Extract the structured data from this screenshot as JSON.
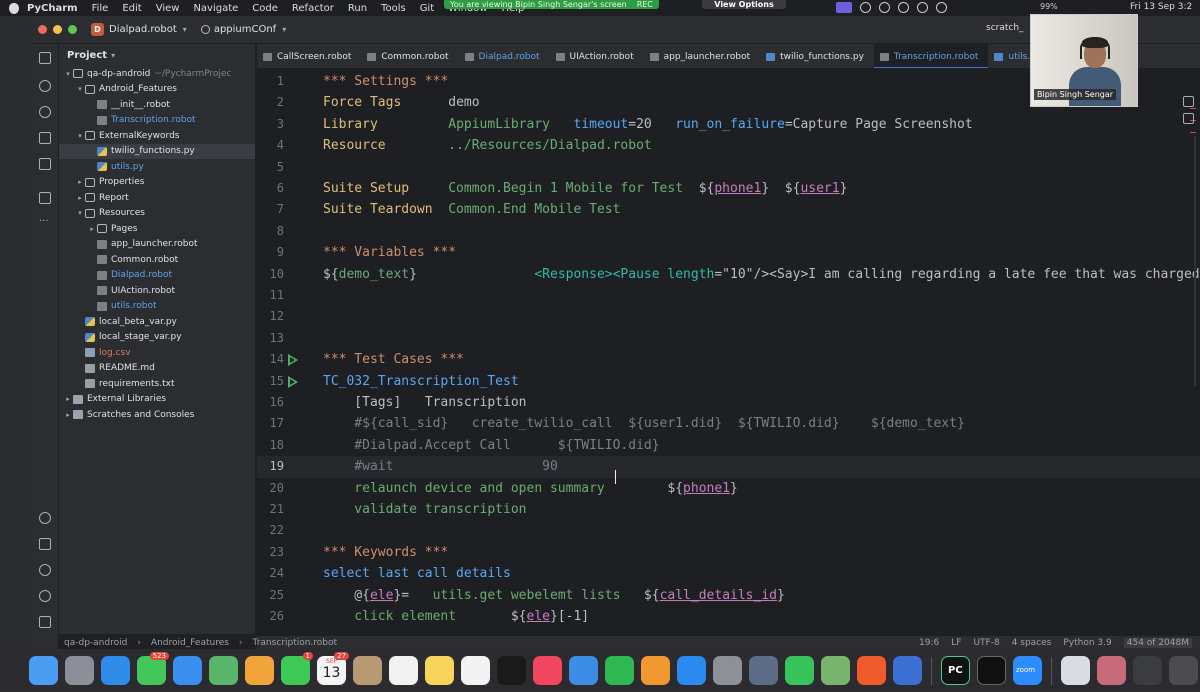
{
  "menubar": {
    "app": "PyCharm",
    "items": [
      "File",
      "Edit",
      "View",
      "Navigate",
      "Code",
      "Refactor",
      "Run",
      "Tools",
      "Git",
      "Window",
      "Help"
    ],
    "share_text": "You are viewing  Bipin Singh Sengar's screen",
    "rec_label": "REC",
    "view_options": "View Options",
    "battery": "99%",
    "clock": "Fri 13 Sep 3:2"
  },
  "titlebar": {
    "project_badge": "D",
    "project": "Dialpad.robot",
    "branch": "appiumCOnf",
    "scratch": "scratch_"
  },
  "project_panel": {
    "title": "Project",
    "rows": [
      {
        "label": "qa-dp-android",
        "suffix": "~/PycharmProjec",
        "depth": 0,
        "arrow": "▾",
        "icon": "folder",
        "style": ""
      },
      {
        "label": "Android_Features",
        "depth": 1,
        "arrow": "▾",
        "icon": "folder",
        "style": ""
      },
      {
        "label": "__init__.robot",
        "depth": 2,
        "arrow": "",
        "icon": "robot",
        "style": ""
      },
      {
        "label": "Transcription.robot",
        "depth": 2,
        "arrow": "",
        "icon": "robot",
        "style": "blue"
      },
      {
        "label": "ExternalKeywords",
        "depth": 1,
        "arrow": "▾",
        "icon": "folder",
        "style": ""
      },
      {
        "label": "twilio_functions.py",
        "depth": 2,
        "arrow": "",
        "icon": "pyy",
        "style": "",
        "selected": true
      },
      {
        "label": "utils.py",
        "depth": 2,
        "arrow": "",
        "icon": "pyy",
        "style": "blue"
      },
      {
        "label": "Properties",
        "depth": 1,
        "arrow": "▸",
        "icon": "folder",
        "style": ""
      },
      {
        "label": "Report",
        "depth": 1,
        "arrow": "▸",
        "icon": "folder",
        "style": ""
      },
      {
        "label": "Resources",
        "depth": 1,
        "arrow": "▾",
        "icon": "folder",
        "style": ""
      },
      {
        "label": "Pages",
        "depth": 2,
        "arrow": "▸",
        "icon": "folder",
        "style": ""
      },
      {
        "label": "app_launcher.robot",
        "depth": 2,
        "arrow": "",
        "icon": "robot",
        "style": ""
      },
      {
        "label": "Common.robot",
        "depth": 2,
        "arrow": "",
        "icon": "robot",
        "style": ""
      },
      {
        "label": "Dialpad.robot",
        "depth": 2,
        "arrow": "",
        "icon": "robot",
        "style": "blue"
      },
      {
        "label": "UIAction.robot",
        "depth": 2,
        "arrow": "",
        "icon": "robot",
        "style": ""
      },
      {
        "label": "utils.robot",
        "depth": 2,
        "arrow": "",
        "icon": "robot",
        "style": "blue"
      },
      {
        "label": "local_beta_var.py",
        "depth": 1,
        "arrow": "",
        "icon": "pyy",
        "style": ""
      },
      {
        "label": "local_stage_var.py",
        "depth": 1,
        "arrow": "",
        "icon": "pyy",
        "style": ""
      },
      {
        "label": "log.csv",
        "depth": 1,
        "arrow": "",
        "icon": "csv",
        "style": "red"
      },
      {
        "label": "README.md",
        "depth": 1,
        "arrow": "",
        "icon": "txt",
        "style": ""
      },
      {
        "label": "requirements.txt",
        "depth": 1,
        "arrow": "",
        "icon": "txt",
        "style": ""
      },
      {
        "label": "External Libraries",
        "depth": 0,
        "arrow": "▸",
        "icon": "lib",
        "style": ""
      },
      {
        "label": "Scratches and Consoles",
        "depth": 0,
        "arrow": "▸",
        "icon": "lib",
        "style": ""
      }
    ]
  },
  "tabs": [
    {
      "label": "CallScreen.robot",
      "type": "robot",
      "style": ""
    },
    {
      "label": "Common.robot",
      "type": "robot",
      "style": ""
    },
    {
      "label": "Dialpad.robot",
      "type": "robot",
      "style": "blue"
    },
    {
      "label": "UIAction.robot",
      "type": "robot",
      "style": ""
    },
    {
      "label": "app_launcher.robot",
      "type": "robot",
      "style": ""
    },
    {
      "label": "twilio_functions.py",
      "type": "py",
      "style": ""
    },
    {
      "label": "Transcription.robot",
      "type": "robot",
      "style": "blue",
      "active": true
    },
    {
      "label": "utils.py",
      "type": "py",
      "style": "blue"
    }
  ],
  "editor": {
    "current_line": 19,
    "lines": [
      {
        "n": "1",
        "t": [
          [
            "*** Settings ***",
            "c-kw"
          ]
        ]
      },
      {
        "n": "2",
        "t": [
          [
            "Force Tags",
            "c-set"
          ],
          [
            "      demo",
            "c-wh"
          ]
        ]
      },
      {
        "n": "3",
        "t": [
          [
            "Library",
            "c-set"
          ],
          [
            "         AppiumLibrary   ",
            "c-grn"
          ],
          [
            "timeout",
            "c-blu"
          ],
          [
            "=20   ",
            "c-wh"
          ],
          [
            "run_on_failure",
            "c-blu"
          ],
          [
            "=Capture Page Screenshot",
            "c-wh"
          ]
        ]
      },
      {
        "n": "4",
        "t": [
          [
            "Resource",
            "c-set"
          ],
          [
            "        ../Resources/Dialpad.robot",
            "c-grn"
          ]
        ]
      },
      {
        "n": "5",
        "t": []
      },
      {
        "n": "6",
        "t": [
          [
            "Suite Setup",
            "c-set"
          ],
          [
            "     Common.Begin 1 Mobile for Test  ",
            "c-grn"
          ],
          [
            "${",
            "c-wh"
          ],
          [
            "phone1",
            "c-mag"
          ],
          [
            "}  ${",
            "c-wh"
          ],
          [
            "user1",
            "c-mag"
          ],
          [
            "}",
            "c-wh"
          ]
        ]
      },
      {
        "n": "7",
        "t": [
          [
            "Suite Teardown",
            "c-set"
          ],
          [
            "  Common.End Mobile Test",
            "c-grn"
          ]
        ]
      },
      {
        "n": "8",
        "t": []
      },
      {
        "n": "9",
        "t": [
          [
            "*** Variables ***",
            "c-kw"
          ]
        ]
      },
      {
        "n": "10",
        "t": [
          [
            "${",
            "c-wh"
          ],
          [
            "demo_text",
            "c-grn"
          ],
          [
            "}",
            "c-wh"
          ],
          [
            "               <Response><Pause length",
            "c-teal"
          ],
          [
            "=\"10\"/><Say>I am calling regarding a late fee that was charged",
            "c-wh"
          ]
        ]
      },
      {
        "n": "11",
        "t": []
      },
      {
        "n": "12",
        "t": []
      },
      {
        "n": "13",
        "t": []
      },
      {
        "n": "14",
        "run": true,
        "t": [
          [
            "*** Test Cases ***",
            "c-kw"
          ]
        ]
      },
      {
        "n": "15",
        "run": true,
        "t": [
          [
            "TC_032_Transcription_Test",
            "c-blu"
          ]
        ]
      },
      {
        "n": "16",
        "t": [
          [
            "    [Tags]   Transcription",
            "c-wh"
          ]
        ]
      },
      {
        "n": "17",
        "t": [
          [
            "    #${call_sid}   create_twilio_call  ${user1.did}  ${TWILIO.did}    ${demo_text}",
            "c-cmt"
          ]
        ]
      },
      {
        "n": "18",
        "t": [
          [
            "    #Dialpad.Accept Call      ${TWILIO.did}",
            "c-cmt"
          ]
        ]
      },
      {
        "n": "19",
        "t": [
          [
            "    #wait                   90",
            "c-cmt"
          ]
        ]
      },
      {
        "n": "20",
        "t": [
          [
            "    relaunch device and open summary",
            "c-grn"
          ],
          [
            "        ${",
            "c-wh"
          ],
          [
            "phone1",
            "c-mag"
          ],
          [
            "}",
            "c-wh"
          ]
        ]
      },
      {
        "n": "21",
        "t": [
          [
            "    validate transcription",
            "c-grn"
          ]
        ]
      },
      {
        "n": "22",
        "t": []
      },
      {
        "n": "23",
        "t": [
          [
            "*** Keywords ***",
            "c-kw"
          ]
        ]
      },
      {
        "n": "24",
        "t": [
          [
            "select last call details",
            "c-blu"
          ]
        ]
      },
      {
        "n": "25",
        "t": [
          [
            "    @{",
            "c-wh"
          ],
          [
            "ele",
            "c-mag"
          ],
          [
            "}=   ",
            "c-wh"
          ],
          [
            "utils.get webelemt lists",
            "c-grn"
          ],
          [
            "   ${",
            "c-wh"
          ],
          [
            "call_details_id",
            "c-mag"
          ],
          [
            "}",
            "c-wh"
          ]
        ]
      },
      {
        "n": "26",
        "t": [
          [
            "    click element",
            "c-grn"
          ],
          [
            "       ${",
            "c-wh"
          ],
          [
            "ele",
            "c-mag"
          ],
          [
            "}[-1]",
            "c-wh"
          ]
        ]
      }
    ]
  },
  "statusbar": {
    "breadcrumb": [
      "qa-dp-android",
      "Android_Features",
      "Transcription.robot"
    ],
    "position": "19:6",
    "line_sep": "LF",
    "encoding": "UTF-8",
    "indent": "4 spaces",
    "interpreter": "Python 3.9",
    "memory": "454 of 2048M"
  },
  "webcam": {
    "name": "Bipin Singh Sengar"
  },
  "dock": {
    "mail_badge": "523",
    "calendar_month": "SEP",
    "calendar_day": "13",
    "calendar_badge": "27",
    "facetime_badge": "1",
    "zoom_label": "zoom",
    "pc_label": "PC",
    "apps": [
      {
        "name": "finder",
        "color": "#4b9df2"
      },
      {
        "name": "launchpad",
        "color": "#8a8f99"
      },
      {
        "name": "safari",
        "color": "#2f8ceb"
      },
      {
        "name": "messages",
        "color": "#43c75b"
      },
      {
        "name": "mail",
        "color": "#3a8ef0"
      },
      {
        "name": "maps",
        "color": "#58b56a"
      },
      {
        "name": "photos",
        "color": "#f0a43a"
      },
      {
        "name": "facetime",
        "color": "#3ec957"
      },
      {
        "name": "calendar",
        "color": "#f4f4f4"
      },
      {
        "name": "contacts",
        "color": "#b89a72"
      },
      {
        "name": "reminders",
        "color": "#f2f2f2"
      },
      {
        "name": "notes",
        "color": "#f6d55a"
      },
      {
        "name": "freeform",
        "color": "#f3f3f3"
      },
      {
        "name": "tv",
        "color": "#1a1a1a"
      },
      {
        "name": "music",
        "color": "#f2475f"
      },
      {
        "name": "keynote",
        "color": "#3b8de6"
      },
      {
        "name": "numbers",
        "color": "#2fb852"
      },
      {
        "name": "pages",
        "color": "#f1982f"
      },
      {
        "name": "app-store",
        "color": "#2a8af0"
      },
      {
        "name": "system-settings",
        "color": "#8d9096"
      },
      {
        "name": "sequel",
        "color": "#5a6c86"
      },
      {
        "name": "whatsapp",
        "color": "#36c45b"
      },
      {
        "name": "chart-app",
        "color": "#7ab56d"
      },
      {
        "name": "brave",
        "color": "#f15a2b"
      },
      {
        "name": "proxyman",
        "color": "#3c6fd4"
      }
    ]
  }
}
